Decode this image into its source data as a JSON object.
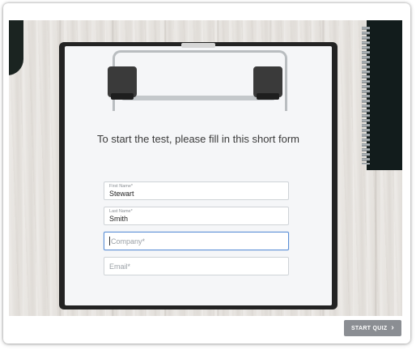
{
  "form": {
    "title": "To start the test, please fill in this short form",
    "fields": [
      {
        "label": "First Name*",
        "value": "Stewart"
      },
      {
        "label": "Last Name*",
        "value": "Smith"
      },
      {
        "placeholder": "Company*",
        "value": ""
      },
      {
        "placeholder": "Email*",
        "value": ""
      }
    ]
  },
  "footer": {
    "start_label": "START QUIZ",
    "start_icon": "chevron-right-icon"
  },
  "colors": {
    "focus_border": "#5b8fd6",
    "button_bg": "#8b8e93"
  }
}
